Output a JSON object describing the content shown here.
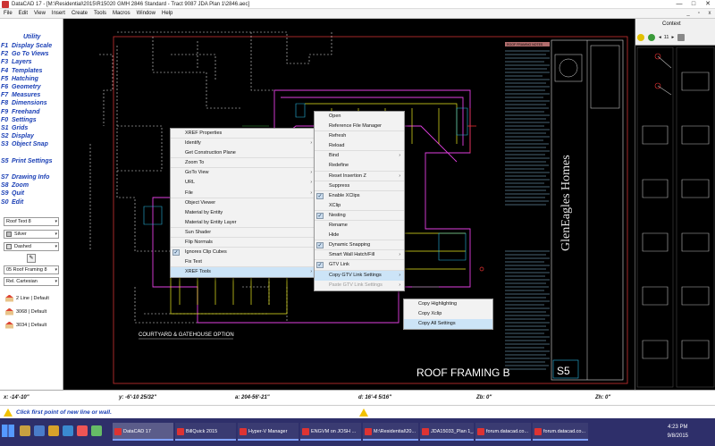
{
  "window": {
    "title": "DataCAD 17 - [M:\\Residential\\2015\\R15020 GMH 2846 Standard - Tract 9087 JDA Plan 1\\2846.aec]",
    "controls": [
      "—",
      "□",
      "✕"
    ]
  },
  "menubar": {
    "items": [
      "File",
      "Edit",
      "View",
      "Insert",
      "Create",
      "Tools",
      "Macros",
      "Window",
      "Help"
    ],
    "mdi_controls": [
      "_",
      "▫",
      "x"
    ]
  },
  "function_keys": {
    "title": "Utility",
    "items": [
      {
        "key": "F1",
        "label": "Display Scale"
      },
      {
        "key": "F2",
        "label": "Go To Views"
      },
      {
        "key": "F3",
        "label": "Layers"
      },
      {
        "key": "F4",
        "label": "Templates"
      },
      {
        "key": "F5",
        "label": "Hatching"
      },
      {
        "key": "F6",
        "label": "Geometry"
      },
      {
        "key": "F7",
        "label": "Measures"
      },
      {
        "key": "F8",
        "label": "Dimensions"
      },
      {
        "key": "F9",
        "label": "Freehand"
      },
      {
        "key": "F0",
        "label": "Settings"
      },
      {
        "key": "S1",
        "label": "Grids"
      },
      {
        "key": "S2",
        "label": "Display"
      },
      {
        "key": "S3",
        "label": "Object Snap"
      },
      {
        "key": "",
        "label": ""
      },
      {
        "key": "S5",
        "label": "Print Settings"
      },
      {
        "key": "",
        "label": ""
      },
      {
        "key": "S7",
        "label": "Drawing Info"
      },
      {
        "key": "S8",
        "label": "Zoom"
      },
      {
        "key": "S9",
        "label": "Quit"
      },
      {
        "key": "S0",
        "label": "Edit"
      }
    ]
  },
  "properties": {
    "text_style": "Roof Text 8",
    "color": "Silver",
    "color_hex": "#c0c0c0",
    "line_type": "Dashed",
    "layer": "05 Roof Framing 8",
    "coord_mode": "Rel. Cartesian",
    "symbols": [
      "2 Line | Default",
      "3068 | Default",
      "3034 | Default"
    ]
  },
  "right_panel": {
    "tab_label": "Context",
    "page_count": "11"
  },
  "drawing": {
    "room_label": "COURTYARD & GATEHOUSE OPTION",
    "sheet_title": "ROOF FRAMING B",
    "sheet_number": "S5",
    "company": "GlenEagles Homes",
    "notes_header": "ROOF FRAMING NOTES"
  },
  "context_menu_primary": {
    "items": [
      {
        "label": "XREF Properties",
        "checked": false,
        "submenu": false
      },
      {
        "label": "Identify",
        "checked": false,
        "submenu": true
      },
      {
        "label": "Get Construction Plane",
        "checked": false,
        "submenu": false
      },
      {
        "label": "Zoom To",
        "checked": false,
        "submenu": false
      },
      {
        "label": "GoTo View",
        "checked": false,
        "submenu": true
      },
      {
        "label": "URL",
        "checked": false,
        "submenu": true
      },
      {
        "label": "File",
        "checked": false,
        "submenu": true
      },
      {
        "label": "Object Viewer",
        "checked": false,
        "submenu": false
      },
      {
        "label": "Material by Entity",
        "checked": false,
        "submenu": false
      },
      {
        "label": "Material by Entity Layer",
        "checked": false,
        "submenu": false
      },
      {
        "label": "Sun Shader",
        "checked": false,
        "submenu": false
      },
      {
        "label": "Flip Normals",
        "checked": false,
        "submenu": false
      },
      {
        "label": "Ignores Clip Cubes",
        "checked": true,
        "submenu": false
      },
      {
        "label": "Fix Text",
        "checked": false,
        "submenu": false
      },
      {
        "label": "XREF Tools",
        "checked": false,
        "submenu": true,
        "highlighted": true
      }
    ]
  },
  "context_menu_xref_tools": {
    "items": [
      {
        "label": "Open",
        "checked": false,
        "submenu": false
      },
      {
        "label": "Reference File Manager",
        "checked": false,
        "submenu": false
      },
      {
        "label": "Refresh",
        "checked": false,
        "submenu": false
      },
      {
        "label": "Reload",
        "checked": false,
        "submenu": false
      },
      {
        "label": "Bind",
        "checked": false,
        "submenu": true
      },
      {
        "label": "Redefine",
        "checked": false,
        "submenu": false
      },
      {
        "label": "Reset Insertion Z",
        "checked": false,
        "submenu": true
      },
      {
        "label": "Suppress",
        "checked": false,
        "submenu": false
      },
      {
        "label": "Enable XClips",
        "checked": true,
        "submenu": false
      },
      {
        "label": "XClip",
        "checked": false,
        "submenu": false
      },
      {
        "label": "Nesting",
        "checked": true,
        "submenu": false
      },
      {
        "label": "Rename",
        "checked": false,
        "submenu": false
      },
      {
        "label": "Hide",
        "checked": false,
        "submenu": false
      },
      {
        "label": "Dynamic Snapping",
        "checked": true,
        "submenu": false
      },
      {
        "label": "Smart Wall Hatch/Fill",
        "checked": false,
        "submenu": true
      },
      {
        "label": "GTV Link",
        "checked": true,
        "submenu": false
      },
      {
        "label": "Copy GTV Link Settings",
        "checked": false,
        "submenu": true,
        "highlighted": true
      },
      {
        "label": "Paste GTV Link Settings",
        "checked": false,
        "submenu": true,
        "disabled": true
      }
    ]
  },
  "context_menu_gtv": {
    "items": [
      {
        "label": "Copy Highlighting"
      },
      {
        "label": "Copy Xclip"
      },
      {
        "label": "Copy All Settings",
        "highlighted": true
      }
    ]
  },
  "coordinates": {
    "x": "x: -14'-10\"",
    "y": "y: -6'-10 25/32\"",
    "a": "a: 204-56'-21\"",
    "d": "d: 16'-4 5/16\"",
    "zb": "Zb: 0\"",
    "zh": "Zh: 0\""
  },
  "status": {
    "message": "Click first point of new line or wall."
  },
  "taskbar": {
    "tasks": [
      "DataCAD 17",
      "BillQuick 2015",
      "Hyper-V Manager",
      "ENGVM on JOSH ...",
      "M:\\Residential\\20...",
      "JDA15033_Plan 1_...",
      "forum.datacad.co...",
      "forum.datacad.co..."
    ],
    "time": "4:23 PM",
    "date": "9/8/2015"
  }
}
